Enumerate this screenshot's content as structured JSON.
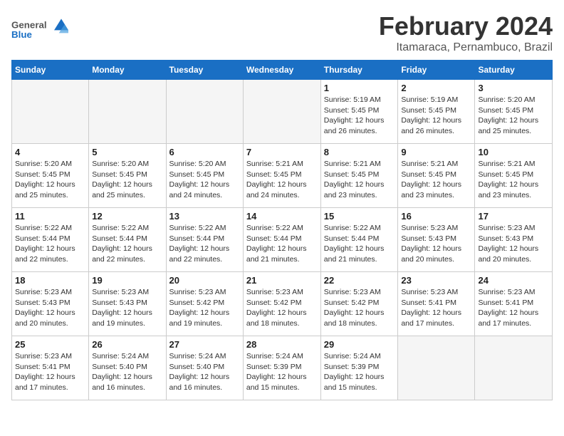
{
  "header": {
    "logo_general": "General",
    "logo_blue": "Blue",
    "month_title": "February 2024",
    "location": "Itamaraca, Pernambuco, Brazil"
  },
  "weekdays": [
    "Sunday",
    "Monday",
    "Tuesday",
    "Wednesday",
    "Thursday",
    "Friday",
    "Saturday"
  ],
  "weeks": [
    [
      {
        "day": "",
        "info": "",
        "empty": true
      },
      {
        "day": "",
        "info": "",
        "empty": true
      },
      {
        "day": "",
        "info": "",
        "empty": true
      },
      {
        "day": "",
        "info": "",
        "empty": true
      },
      {
        "day": "1",
        "info": "Sunrise: 5:19 AM\nSunset: 5:45 PM\nDaylight: 12 hours\nand 26 minutes."
      },
      {
        "day": "2",
        "info": "Sunrise: 5:19 AM\nSunset: 5:45 PM\nDaylight: 12 hours\nand 26 minutes."
      },
      {
        "day": "3",
        "info": "Sunrise: 5:20 AM\nSunset: 5:45 PM\nDaylight: 12 hours\nand 25 minutes."
      }
    ],
    [
      {
        "day": "4",
        "info": "Sunrise: 5:20 AM\nSunset: 5:45 PM\nDaylight: 12 hours\nand 25 minutes."
      },
      {
        "day": "5",
        "info": "Sunrise: 5:20 AM\nSunset: 5:45 PM\nDaylight: 12 hours\nand 25 minutes."
      },
      {
        "day": "6",
        "info": "Sunrise: 5:20 AM\nSunset: 5:45 PM\nDaylight: 12 hours\nand 24 minutes."
      },
      {
        "day": "7",
        "info": "Sunrise: 5:21 AM\nSunset: 5:45 PM\nDaylight: 12 hours\nand 24 minutes."
      },
      {
        "day": "8",
        "info": "Sunrise: 5:21 AM\nSunset: 5:45 PM\nDaylight: 12 hours\nand 23 minutes."
      },
      {
        "day": "9",
        "info": "Sunrise: 5:21 AM\nSunset: 5:45 PM\nDaylight: 12 hours\nand 23 minutes."
      },
      {
        "day": "10",
        "info": "Sunrise: 5:21 AM\nSunset: 5:45 PM\nDaylight: 12 hours\nand 23 minutes."
      }
    ],
    [
      {
        "day": "11",
        "info": "Sunrise: 5:22 AM\nSunset: 5:44 PM\nDaylight: 12 hours\nand 22 minutes."
      },
      {
        "day": "12",
        "info": "Sunrise: 5:22 AM\nSunset: 5:44 PM\nDaylight: 12 hours\nand 22 minutes."
      },
      {
        "day": "13",
        "info": "Sunrise: 5:22 AM\nSunset: 5:44 PM\nDaylight: 12 hours\nand 22 minutes."
      },
      {
        "day": "14",
        "info": "Sunrise: 5:22 AM\nSunset: 5:44 PM\nDaylight: 12 hours\nand 21 minutes."
      },
      {
        "day": "15",
        "info": "Sunrise: 5:22 AM\nSunset: 5:44 PM\nDaylight: 12 hours\nand 21 minutes."
      },
      {
        "day": "16",
        "info": "Sunrise: 5:23 AM\nSunset: 5:43 PM\nDaylight: 12 hours\nand 20 minutes."
      },
      {
        "day": "17",
        "info": "Sunrise: 5:23 AM\nSunset: 5:43 PM\nDaylight: 12 hours\nand 20 minutes."
      }
    ],
    [
      {
        "day": "18",
        "info": "Sunrise: 5:23 AM\nSunset: 5:43 PM\nDaylight: 12 hours\nand 20 minutes."
      },
      {
        "day": "19",
        "info": "Sunrise: 5:23 AM\nSunset: 5:43 PM\nDaylight: 12 hours\nand 19 minutes."
      },
      {
        "day": "20",
        "info": "Sunrise: 5:23 AM\nSunset: 5:42 PM\nDaylight: 12 hours\nand 19 minutes."
      },
      {
        "day": "21",
        "info": "Sunrise: 5:23 AM\nSunset: 5:42 PM\nDaylight: 12 hours\nand 18 minutes."
      },
      {
        "day": "22",
        "info": "Sunrise: 5:23 AM\nSunset: 5:42 PM\nDaylight: 12 hours\nand 18 minutes."
      },
      {
        "day": "23",
        "info": "Sunrise: 5:23 AM\nSunset: 5:41 PM\nDaylight: 12 hours\nand 17 minutes."
      },
      {
        "day": "24",
        "info": "Sunrise: 5:23 AM\nSunset: 5:41 PM\nDaylight: 12 hours\nand 17 minutes."
      }
    ],
    [
      {
        "day": "25",
        "info": "Sunrise: 5:23 AM\nSunset: 5:41 PM\nDaylight: 12 hours\nand 17 minutes."
      },
      {
        "day": "26",
        "info": "Sunrise: 5:24 AM\nSunset: 5:40 PM\nDaylight: 12 hours\nand 16 minutes."
      },
      {
        "day": "27",
        "info": "Sunrise: 5:24 AM\nSunset: 5:40 PM\nDaylight: 12 hours\nand 16 minutes."
      },
      {
        "day": "28",
        "info": "Sunrise: 5:24 AM\nSunset: 5:39 PM\nDaylight: 12 hours\nand 15 minutes."
      },
      {
        "day": "29",
        "info": "Sunrise: 5:24 AM\nSunset: 5:39 PM\nDaylight: 12 hours\nand 15 minutes."
      },
      {
        "day": "",
        "info": "",
        "empty": true
      },
      {
        "day": "",
        "info": "",
        "empty": true
      }
    ]
  ]
}
